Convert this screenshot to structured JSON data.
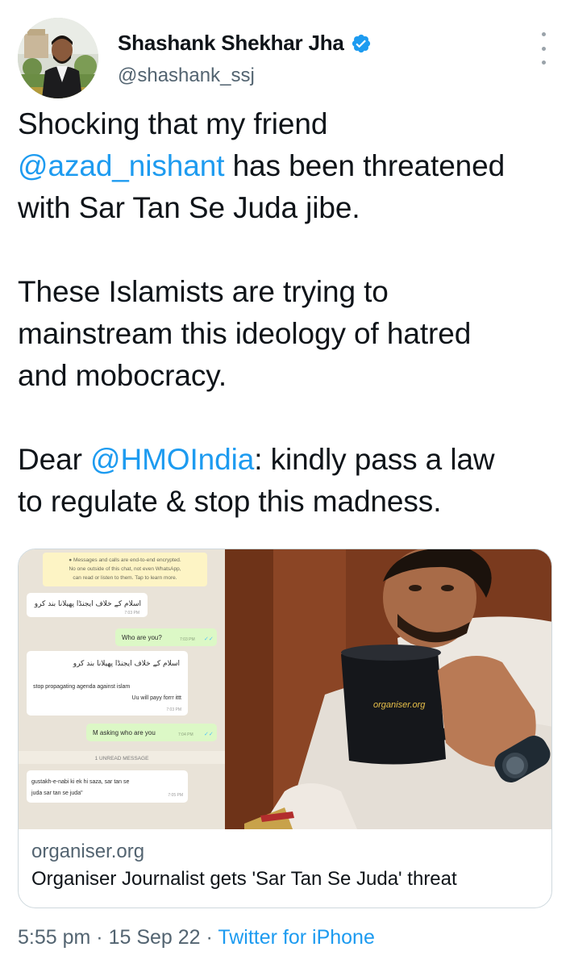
{
  "author": {
    "display_name": "Shashank Shekhar Jha",
    "handle": "@shashank_ssj",
    "verified": true
  },
  "icons": {
    "verified": "verified-badge-icon",
    "more": "more-vertical-icon"
  },
  "tweet": {
    "line1": "Shocking that my friend",
    "mention1": "@azad_nishant",
    "line2_rest": " has been threatened",
    "line3": "with Sar Tan Se Juda jibe.",
    "line4": "These Islamists are trying to",
    "line5": "mainstream this ideology of hatred",
    "line6": "and mobocracy.",
    "line7_prefix": "Dear ",
    "mention2": "@HMOIndia",
    "line7_rest": ": kindly pass a law",
    "line8": "to regulate & stop this madness."
  },
  "card": {
    "domain": "organiser.org",
    "title": "Organiser Journalist gets 'Sar Tan Se Juda' threat",
    "chat": {
      "notice_line1": "● Messages and calls are end-to-end encrypted.",
      "notice_line2": "No one outside of this chat, not even WhatsApp,",
      "notice_line3": "can read or listen to them. Tap to learn more.",
      "msg1": "اسلام کے خلاف ایجنڈا پھیلانا بند کرو",
      "msg1_time": "7:03 PM",
      "msg2": "Who are you?",
      "msg2_time": "7:03 PM",
      "msg3_urdu": "اسلام کے خلاف ایجنڈا پھیلانا بند کرو",
      "msg3_line1": "stop propagating agenda against islam",
      "msg3_line2": "Uu will payy forrr ittt",
      "msg3_time": "7:03 PM",
      "msg4": "M asking who are you",
      "msg4_time": "7:04 PM",
      "unread": "1 UNREAD MESSAGE",
      "msg5_line1": "gustakh-e-nabi ki ek hi saza, sar tan se",
      "msg5_line2": "juda sar tan se juda\"",
      "msg5_time": "7:05 PM"
    },
    "mug_text": "organiser.org"
  },
  "footer": {
    "time": "5:55 pm",
    "sep1": " · ",
    "date": "15 Sep 22",
    "sep2": " · ",
    "source": "Twitter for iPhone"
  },
  "colors": {
    "accent": "#1d9bf0",
    "secondary_text": "#536471",
    "whatsapp_bg": "#e5ddd5",
    "whatsapp_sent": "#dcf8c6"
  }
}
